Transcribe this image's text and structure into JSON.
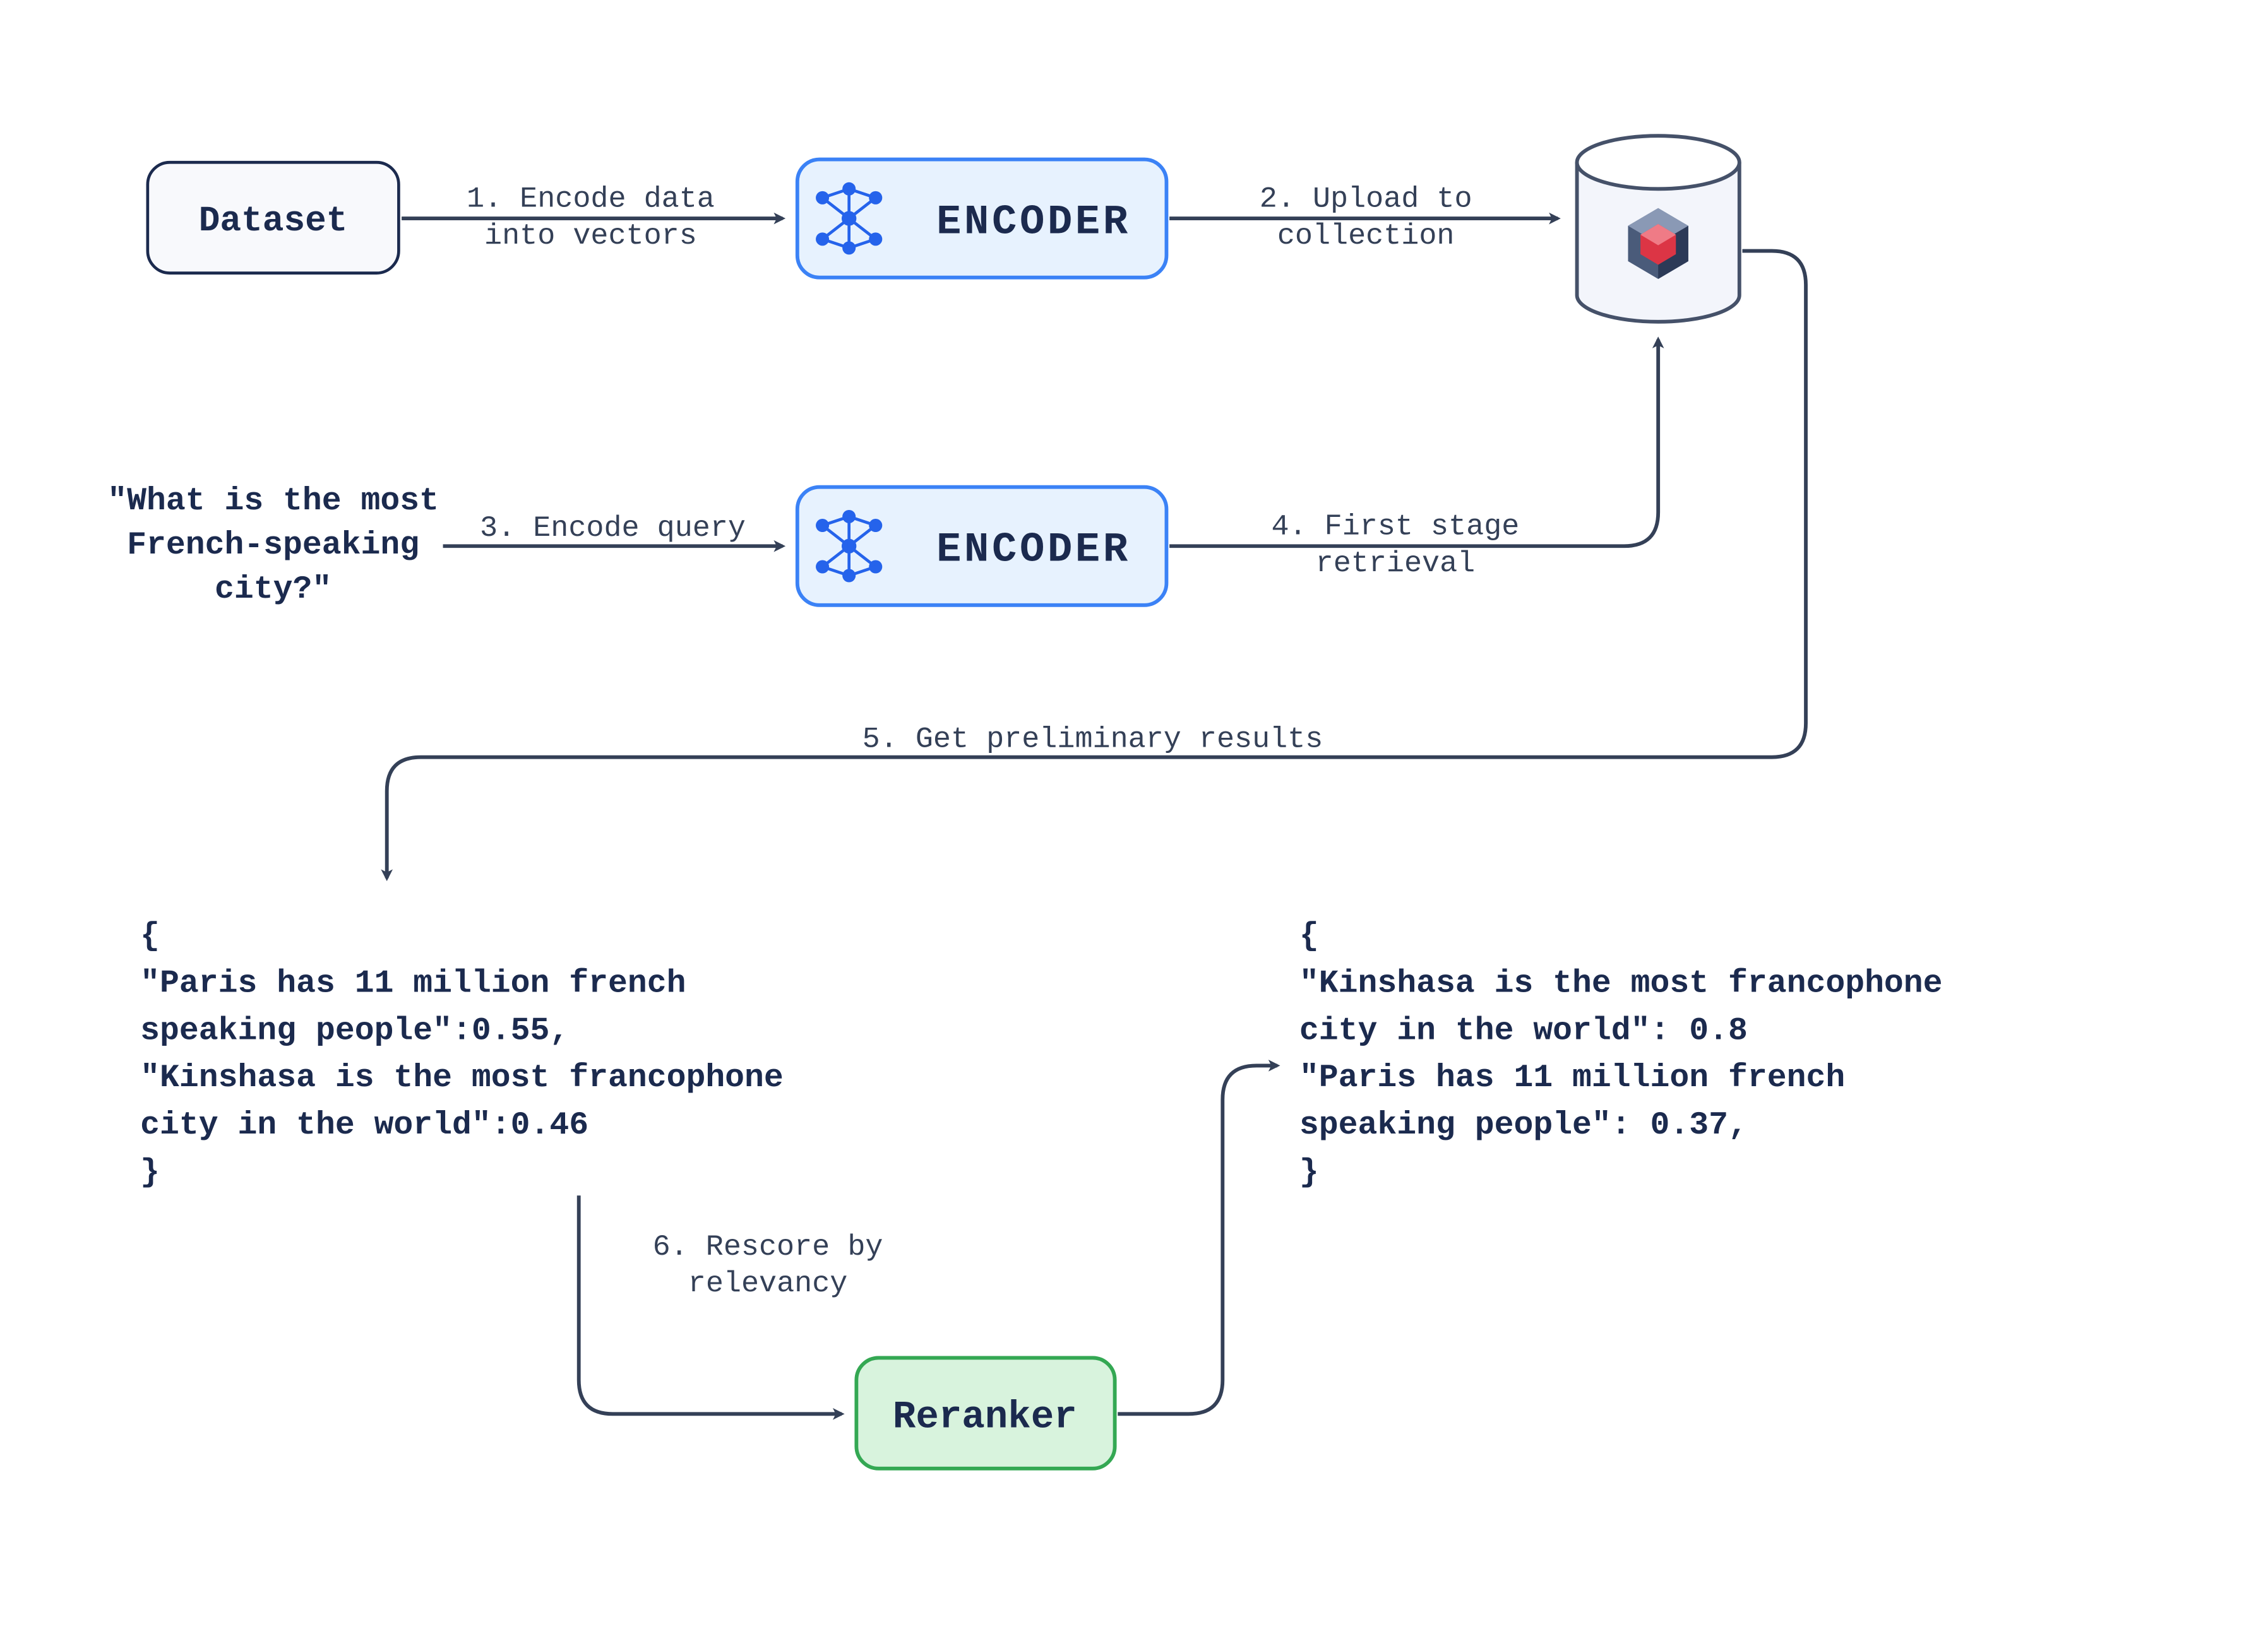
{
  "nodes": {
    "dataset": "Dataset",
    "encoder1": "ENCODER",
    "encoder2": "ENCODER",
    "reranker": "Reranker"
  },
  "query": {
    "line1": "\"What is the most",
    "line2": "French-speaking",
    "line3": "city?\""
  },
  "steps": {
    "s1a": "1. Encode data",
    "s1b": "into vectors",
    "s2a": "2. Upload to",
    "s2b": "collection",
    "s3": "3. Encode query",
    "s4a": "4. First stage",
    "s4b": "retrieval",
    "s5": "5. Get preliminary results",
    "s6a": "6. Rescore by",
    "s6b": "relevancy"
  },
  "prelim": {
    "l1": "{",
    "l2": "\"Paris has 11 million french",
    "l3": "speaking people\":0.55,",
    "l4": "\"Kinshasa is the most francophone",
    "l5": "city in the world\":0.46",
    "l6": "}"
  },
  "final": {
    "l1": "{",
    "l2": "\"Kinshasa is the most francophone",
    "l3": "city in the world\": 0.8",
    "l4": "\"Paris has 11 million french",
    "l5": "speaking people\": 0.37,",
    "l6": "}"
  }
}
